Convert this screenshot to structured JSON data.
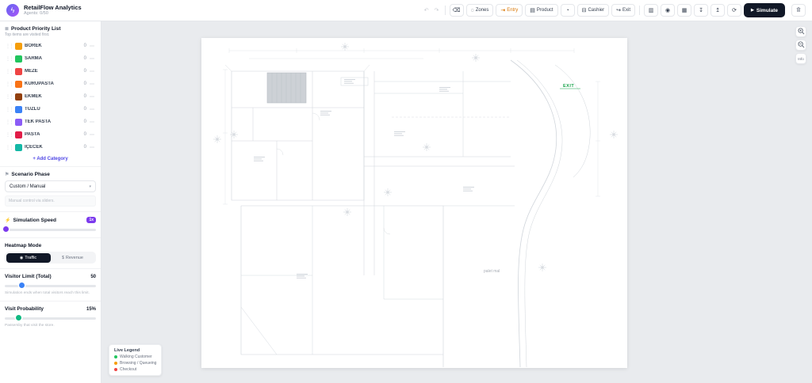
{
  "header": {
    "title": "RetailFlow Analytics",
    "subtitle": "Agents: 0/50",
    "toolbar": {
      "zones": "Zones",
      "entry": "Entry",
      "product": "Product",
      "cashier": "Cashier",
      "exit": "Exit",
      "simulate": "Simulate"
    }
  },
  "icons": {
    "logo": "ϟ",
    "undo": "↶",
    "redo": "↷",
    "eraser": "⌫",
    "zones": "◌",
    "entry": "⇥",
    "product": "▤",
    "paint": "◔",
    "cashier": "⊟",
    "exit": "↪",
    "chart": "▥",
    "camera": "◉",
    "grid": "▦",
    "download": "↧",
    "upload": "↥",
    "refresh": "⟳",
    "play": "▶",
    "drag": "⋮⋮",
    "more": "⋯",
    "plus": "+",
    "list": "≣",
    "flag": "⚑",
    "bolt": "⚡",
    "chevron": "▾",
    "traffic": "◉",
    "revenue": "$"
  },
  "colors": {
    "accent_purple": "#7c3aed",
    "entry_amber": "#d97706",
    "simulate_bg": "#111827",
    "exit_green": "#16a34a",
    "visitor_blue": "#3b82f6",
    "probability_green": "#10b981"
  },
  "sidebar": {
    "priority": {
      "title": "Product Priority List",
      "subtitle": "Top items are visited first.",
      "add_label": "Add Category",
      "items": [
        {
          "label": "BÖREK",
          "count": "0",
          "color": "#f59e0b"
        },
        {
          "label": "SARMA",
          "count": "0",
          "color": "#22c55e"
        },
        {
          "label": "MEZE",
          "count": "0",
          "color": "#ef4444"
        },
        {
          "label": "KURUPASTA",
          "count": "0",
          "color": "#f97316"
        },
        {
          "label": "EKMEK",
          "count": "0",
          "color": "#92400e"
        },
        {
          "label": "TUZLU",
          "count": "0",
          "color": "#3b82f6"
        },
        {
          "label": "TEK PASTA",
          "count": "0",
          "color": "#8b5cf6"
        },
        {
          "label": "PASTA",
          "count": "0",
          "color": "#e11d48"
        },
        {
          "label": "İÇECEK",
          "count": "0",
          "color": "#14b8a6"
        }
      ]
    },
    "scenario": {
      "title": "Scenario Phase",
      "selected": "Custom / Manual",
      "hint": "Manual control via sliders."
    },
    "speed": {
      "title": "Simulation Speed",
      "badge": "1x",
      "thumb": "1%"
    },
    "heatmap": {
      "title": "Heatmap Mode",
      "options": [
        "Traffic",
        "Revenue"
      ]
    },
    "visitor_limit": {
      "title": "Visitor Limit (Total)",
      "value": "50",
      "thumb": "18%",
      "hint": "Simulation ends when total visitors reach this limit."
    },
    "visit_probability": {
      "title": "Visit Probability",
      "value": "15%",
      "thumb": "15%",
      "hint": "Passersby that visit the store."
    }
  },
  "canvas": {
    "exit_label": "EXIT",
    "plan_note": "palet mal",
    "zoom": {
      "info": "Info"
    },
    "legend": {
      "title": "Live Legend",
      "items": [
        {
          "label": "Walking Customer",
          "color": "#22c55e"
        },
        {
          "label": "Browsing / Queueing",
          "color": "#f59e0b"
        },
        {
          "label": "Checkout",
          "color": "#ef4444"
        }
      ]
    }
  }
}
